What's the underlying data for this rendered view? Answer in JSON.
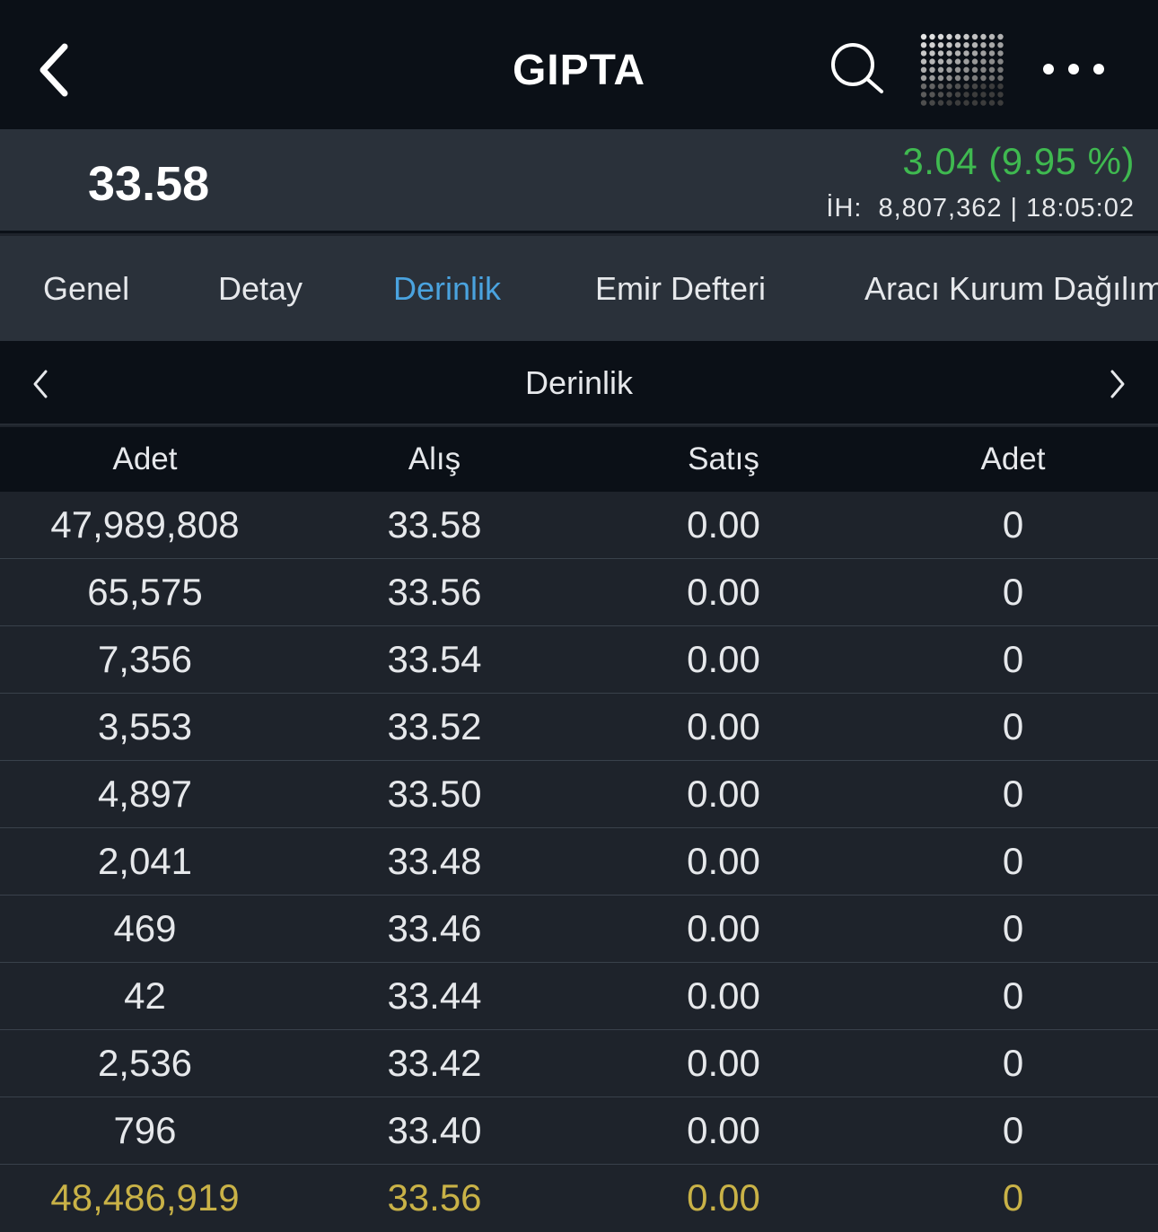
{
  "header": {
    "title": "GIPTA"
  },
  "quote": {
    "last_price": "33.58",
    "change": "3.04 (9.95 %)",
    "volume_label": "İH:",
    "volume_time": "8,807,362 | 18:05:02",
    "change_color": "#3fb950"
  },
  "tabs": [
    {
      "label": "Genel"
    },
    {
      "label": "Detay"
    },
    {
      "label": "Derinlik"
    },
    {
      "label": "Emir Defteri"
    },
    {
      "label": "Aracı Kurum Dağılım"
    }
  ],
  "active_tab": "Derinlik",
  "sub": {
    "title": "Derinlik"
  },
  "columns": [
    "Adet",
    "Alış",
    "Satış",
    "Adet"
  ],
  "rows": [
    [
      "47,989,808",
      "33.58",
      "0.00",
      "0"
    ],
    [
      "65,575",
      "33.56",
      "0.00",
      "0"
    ],
    [
      "7,356",
      "33.54",
      "0.00",
      "0"
    ],
    [
      "3,553",
      "33.52",
      "0.00",
      "0"
    ],
    [
      "4,897",
      "33.50",
      "0.00",
      "0"
    ],
    [
      "2,041",
      "33.48",
      "0.00",
      "0"
    ],
    [
      "469",
      "33.46",
      "0.00",
      "0"
    ],
    [
      "42",
      "33.44",
      "0.00",
      "0"
    ],
    [
      "2,536",
      "33.42",
      "0.00",
      "0"
    ],
    [
      "796",
      "33.40",
      "0.00",
      "0"
    ]
  ],
  "total": [
    "48,486,919",
    "33.56",
    "0.00",
    "0"
  ],
  "colors": {
    "accent": "#4aa3df",
    "total": "#c9b247",
    "background": "#1e232b",
    "header_bg": "#0b1017"
  },
  "icons": {
    "back": "chevron-left-icon",
    "search": "search-icon",
    "grid": "dot-grid-icon",
    "more": "more-horizontal-icon",
    "prev": "chevron-left-icon",
    "next": "chevron-right-icon"
  }
}
